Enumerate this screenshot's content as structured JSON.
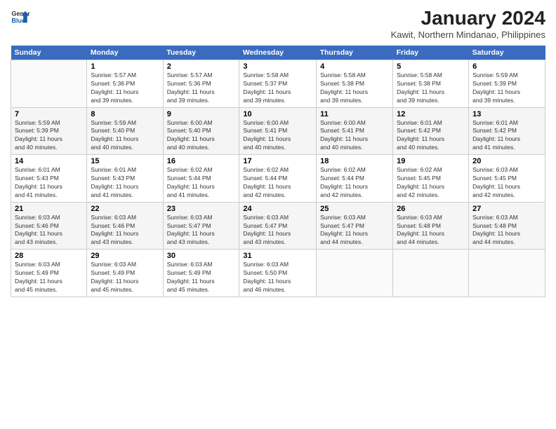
{
  "header": {
    "logo_general": "General",
    "logo_blue": "Blue",
    "title": "January 2024",
    "subtitle": "Kawit, Northern Mindanao, Philippines"
  },
  "calendar": {
    "days_of_week": [
      "Sunday",
      "Monday",
      "Tuesday",
      "Wednesday",
      "Thursday",
      "Friday",
      "Saturday"
    ],
    "weeks": [
      [
        {
          "num": "",
          "info": ""
        },
        {
          "num": "1",
          "info": "Sunrise: 5:57 AM\nSunset: 5:36 PM\nDaylight: 11 hours\nand 39 minutes."
        },
        {
          "num": "2",
          "info": "Sunrise: 5:57 AM\nSunset: 5:36 PM\nDaylight: 11 hours\nand 39 minutes."
        },
        {
          "num": "3",
          "info": "Sunrise: 5:58 AM\nSunset: 5:37 PM\nDaylight: 11 hours\nand 39 minutes."
        },
        {
          "num": "4",
          "info": "Sunrise: 5:58 AM\nSunset: 5:38 PM\nDaylight: 11 hours\nand 39 minutes."
        },
        {
          "num": "5",
          "info": "Sunrise: 5:58 AM\nSunset: 5:38 PM\nDaylight: 11 hours\nand 39 minutes."
        },
        {
          "num": "6",
          "info": "Sunrise: 5:59 AM\nSunset: 5:39 PM\nDaylight: 11 hours\nand 39 minutes."
        }
      ],
      [
        {
          "num": "7",
          "info": "Sunrise: 5:59 AM\nSunset: 5:39 PM\nDaylight: 11 hours\nand 40 minutes."
        },
        {
          "num": "8",
          "info": "Sunrise: 5:59 AM\nSunset: 5:40 PM\nDaylight: 11 hours\nand 40 minutes."
        },
        {
          "num": "9",
          "info": "Sunrise: 6:00 AM\nSunset: 5:40 PM\nDaylight: 11 hours\nand 40 minutes."
        },
        {
          "num": "10",
          "info": "Sunrise: 6:00 AM\nSunset: 5:41 PM\nDaylight: 11 hours\nand 40 minutes."
        },
        {
          "num": "11",
          "info": "Sunrise: 6:00 AM\nSunset: 5:41 PM\nDaylight: 11 hours\nand 40 minutes."
        },
        {
          "num": "12",
          "info": "Sunrise: 6:01 AM\nSunset: 5:42 PM\nDaylight: 11 hours\nand 40 minutes."
        },
        {
          "num": "13",
          "info": "Sunrise: 6:01 AM\nSunset: 5:42 PM\nDaylight: 11 hours\nand 41 minutes."
        }
      ],
      [
        {
          "num": "14",
          "info": "Sunrise: 6:01 AM\nSunset: 5:43 PM\nDaylight: 11 hours\nand 41 minutes."
        },
        {
          "num": "15",
          "info": "Sunrise: 6:01 AM\nSunset: 5:43 PM\nDaylight: 11 hours\nand 41 minutes."
        },
        {
          "num": "16",
          "info": "Sunrise: 6:02 AM\nSunset: 5:44 PM\nDaylight: 11 hours\nand 41 minutes."
        },
        {
          "num": "17",
          "info": "Sunrise: 6:02 AM\nSunset: 5:44 PM\nDaylight: 11 hours\nand 42 minutes."
        },
        {
          "num": "18",
          "info": "Sunrise: 6:02 AM\nSunset: 5:44 PM\nDaylight: 11 hours\nand 42 minutes."
        },
        {
          "num": "19",
          "info": "Sunrise: 6:02 AM\nSunset: 5:45 PM\nDaylight: 11 hours\nand 42 minutes."
        },
        {
          "num": "20",
          "info": "Sunrise: 6:03 AM\nSunset: 5:45 PM\nDaylight: 11 hours\nand 42 minutes."
        }
      ],
      [
        {
          "num": "21",
          "info": "Sunrise: 6:03 AM\nSunset: 5:46 PM\nDaylight: 11 hours\nand 43 minutes."
        },
        {
          "num": "22",
          "info": "Sunrise: 6:03 AM\nSunset: 5:46 PM\nDaylight: 11 hours\nand 43 minutes."
        },
        {
          "num": "23",
          "info": "Sunrise: 6:03 AM\nSunset: 5:47 PM\nDaylight: 11 hours\nand 43 minutes."
        },
        {
          "num": "24",
          "info": "Sunrise: 6:03 AM\nSunset: 5:47 PM\nDaylight: 11 hours\nand 43 minutes."
        },
        {
          "num": "25",
          "info": "Sunrise: 6:03 AM\nSunset: 5:47 PM\nDaylight: 11 hours\nand 44 minutes."
        },
        {
          "num": "26",
          "info": "Sunrise: 6:03 AM\nSunset: 5:48 PM\nDaylight: 11 hours\nand 44 minutes."
        },
        {
          "num": "27",
          "info": "Sunrise: 6:03 AM\nSunset: 5:48 PM\nDaylight: 11 hours\nand 44 minutes."
        }
      ],
      [
        {
          "num": "28",
          "info": "Sunrise: 6:03 AM\nSunset: 5:49 PM\nDaylight: 11 hours\nand 45 minutes."
        },
        {
          "num": "29",
          "info": "Sunrise: 6:03 AM\nSunset: 5:49 PM\nDaylight: 11 hours\nand 45 minutes."
        },
        {
          "num": "30",
          "info": "Sunrise: 6:03 AM\nSunset: 5:49 PM\nDaylight: 11 hours\nand 45 minutes."
        },
        {
          "num": "31",
          "info": "Sunrise: 6:03 AM\nSunset: 5:50 PM\nDaylight: 11 hours\nand 46 minutes."
        },
        {
          "num": "",
          "info": ""
        },
        {
          "num": "",
          "info": ""
        },
        {
          "num": "",
          "info": ""
        }
      ]
    ]
  }
}
